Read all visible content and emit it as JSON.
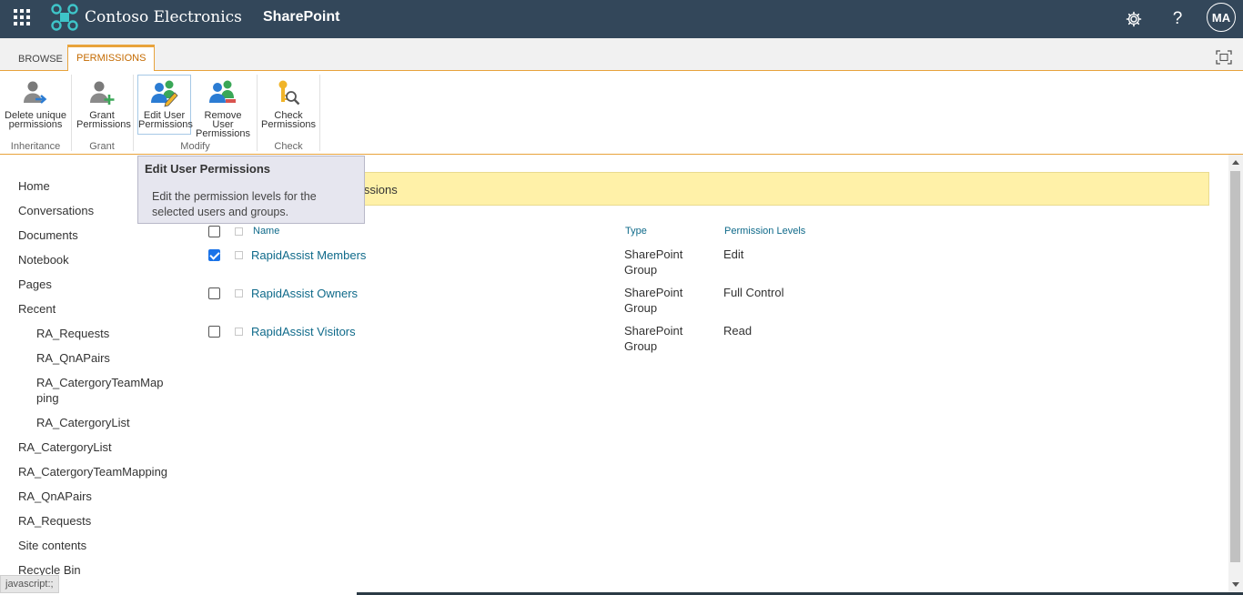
{
  "suitebar": {
    "brand": "Contoso Electronics",
    "app": "SharePoint",
    "avatar_initials": "MA",
    "icons": [
      "waffle-icon",
      "gear-icon",
      "help-icon"
    ],
    "color": "#33475a"
  },
  "ribbon": {
    "tabs": [
      {
        "label": "BROWSE",
        "active": false
      },
      {
        "label": "PERMISSIONS",
        "active": true
      }
    ],
    "groups": [
      {
        "label": "Inheritance"
      },
      {
        "label": "Grant"
      },
      {
        "label": "Modify"
      },
      {
        "label": "Check"
      }
    ],
    "buttons": [
      {
        "line1": "Delete unique",
        "line2": "permissions",
        "icon": "delete-permissions-icon"
      },
      {
        "line1": "Grant",
        "line2": "Permissions",
        "icon": "grant-permissions-icon"
      },
      {
        "line1": "Edit User",
        "line2": "Permissions",
        "icon": "edit-user-permissions-icon",
        "selected": true
      },
      {
        "line1": "Remove User",
        "line2": "Permissions",
        "icon": "remove-user-permissions-icon"
      },
      {
        "line1": "Check",
        "line2": "Permissions",
        "icon": "check-permissions-icon"
      }
    ],
    "accent": "#e8a33c"
  },
  "tooltip": {
    "title": "Edit User Permissions",
    "body": "Edit the permission levels for the selected users and groups."
  },
  "leftnav": {
    "items": [
      "Home",
      "Conversations",
      "Documents",
      "Notebook",
      "Pages",
      "Recent",
      "RA_Requests",
      "RA_QnAPairs",
      "RA_CatergoryTeamMap",
      "RA_CatergoryList",
      "RA_CatergoryList",
      "RA_CatergoryTeamMapping",
      "RA_QnAPairs",
      "RA_Requests",
      "Site contents",
      "Recycle Bin"
    ],
    "wrap_suffix": "ping"
  },
  "banner": {
    "text_visible": "issions",
    "color": "#fff1a8"
  },
  "table": {
    "headers": {
      "name": "Name",
      "type": "Type",
      "permission": "Permission Levels"
    },
    "rows": [
      {
        "name": "RapidAssist Members",
        "type_line1": "SharePoint",
        "type_line2": "Group",
        "permission": "Edit",
        "checked": true
      },
      {
        "name": "RapidAssist Owners",
        "type_line1": "SharePoint",
        "type_line2": "Group",
        "permission": "Full Control",
        "checked": false
      },
      {
        "name": "RapidAssist Visitors",
        "type_line1": "SharePoint",
        "type_line2": "Group",
        "permission": "Read",
        "checked": false
      }
    ],
    "link_color": "#0f6a8a"
  },
  "statusbar": {
    "text": "javascript:;"
  }
}
